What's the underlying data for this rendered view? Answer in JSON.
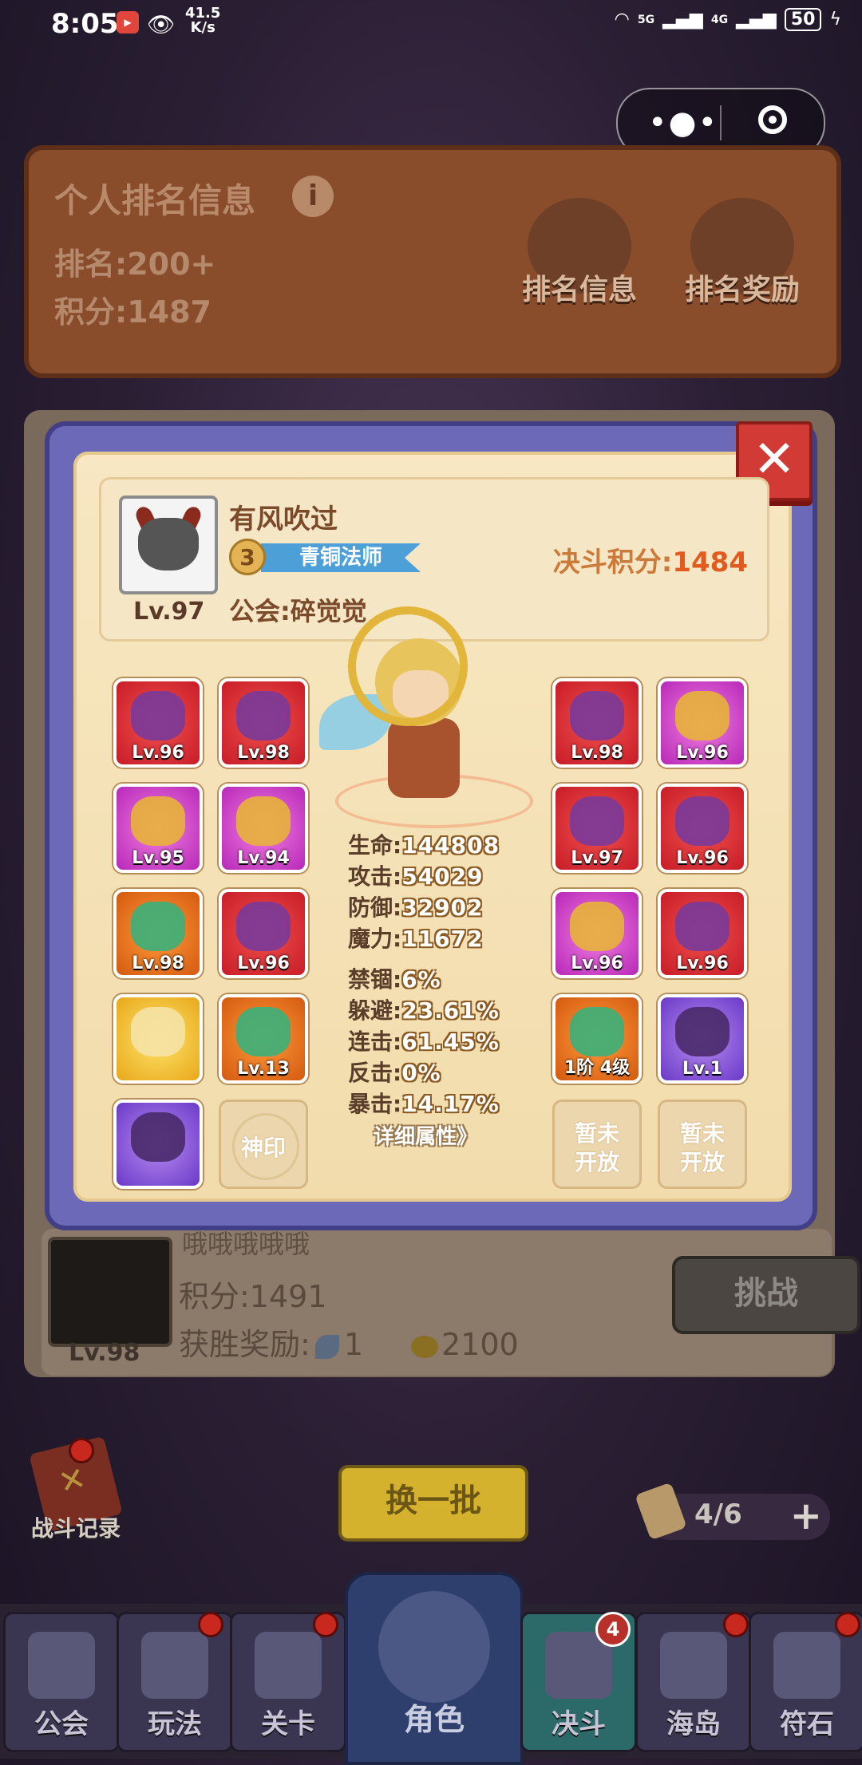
{
  "status_bar": {
    "time": "8:05",
    "speed_value": "41.5",
    "speed_unit": "K/s",
    "signal_1": "5G",
    "signal_2": "4G",
    "battery": "50"
  },
  "ranking_panel": {
    "title": "个人排名信息",
    "rank_line": "排名:200+",
    "score_line": "积分:1487",
    "rank_info_label": "排名信息",
    "rank_reward_label": "排名奖励"
  },
  "modal": {
    "close_symbol": "✕",
    "player": {
      "name": "有风吹过",
      "level": "Lv.97",
      "rank_number": "3",
      "rank_title": "青铜法师",
      "guild": "公会:碎觉觉",
      "duel_score_label": "决斗积分:",
      "duel_score_value": "1484"
    },
    "left_slots": [
      {
        "level": "Lv.96",
        "color": "red"
      },
      {
        "level": "Lv.98",
        "color": "red"
      },
      {
        "level": "Lv.95",
        "color": "pink"
      },
      {
        "level": "Lv.94",
        "color": "pink"
      },
      {
        "level": "Lv.98",
        "color": "orange"
      },
      {
        "level": "Lv.96",
        "color": "red"
      },
      {
        "level": "",
        "color": "yellow"
      },
      {
        "level": "Lv.13",
        "color": "orange"
      },
      {
        "level": "",
        "color": "purple"
      },
      {
        "level": "神印",
        "color": "locked"
      }
    ],
    "right_slots": [
      {
        "level": "Lv.98",
        "color": "red"
      },
      {
        "level": "Lv.96",
        "color": "pink"
      },
      {
        "level": "Lv.97",
        "color": "red"
      },
      {
        "level": "Lv.96",
        "color": "red"
      },
      {
        "level": "Lv.96",
        "color": "pink"
      },
      {
        "level": "Lv.96",
        "color": "red"
      },
      {
        "level": "1阶 4级",
        "color": "orange"
      },
      {
        "level": "Lv.1",
        "color": "purple"
      },
      {
        "level": "暂未开放",
        "color": "locked"
      },
      {
        "level": "暂未开放",
        "color": "locked"
      }
    ],
    "locked_top": "暂未",
    "locked_bottom": "开放",
    "stats": [
      {
        "label": "生命:",
        "value": "144808"
      },
      {
        "label": "攻击:",
        "value": "54029"
      },
      {
        "label": "防御:",
        "value": "32902"
      },
      {
        "label": "魔力:",
        "value": "11672"
      },
      {
        "label": "禁锢:",
        "value": "6%"
      },
      {
        "label": "躲避:",
        "value": "23.61%"
      },
      {
        "label": "连击:",
        "value": "61.45%"
      },
      {
        "label": "反击:",
        "value": "0%"
      },
      {
        "label": "暴击:",
        "value": "14.17%"
      }
    ],
    "detail_link": "详细属性》"
  },
  "opponent": {
    "name": "哦哦哦哦哦",
    "score": "积分:1491",
    "reward_label": "获胜奖励:",
    "reward_feather": "1",
    "reward_gold": "2100",
    "level": "Lv.98",
    "challenge_label": "挑战"
  },
  "controls": {
    "battle_log_label": "战斗记录",
    "refresh_label": "换一批",
    "tickets": "4/6",
    "plus": "+"
  },
  "nav": {
    "items": [
      {
        "label": "公会"
      },
      {
        "label": "玩法"
      },
      {
        "label": "关卡"
      },
      {
        "label": "角色"
      },
      {
        "label": "决斗"
      },
      {
        "label": "海岛"
      },
      {
        "label": "符石"
      }
    ],
    "duel_badge": "4"
  }
}
